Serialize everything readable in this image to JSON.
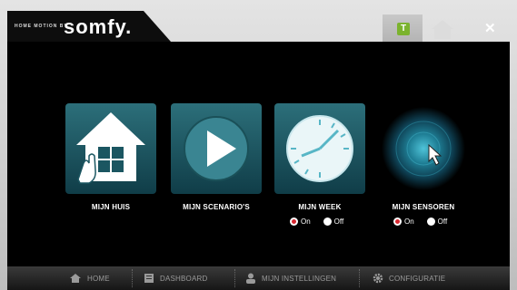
{
  "header": {
    "brand_small": "HOME MOTION BY",
    "brand_logo": "somfy.",
    "tab_t_label": "T",
    "close_label": "✕"
  },
  "tiles": [
    {
      "label": "MIJN HUIS",
      "icon": "house-hand-icon"
    },
    {
      "label": "MIJN SCENARIO'S",
      "icon": "play-icon"
    },
    {
      "label": "MIJN WEEK",
      "icon": "clock-icon",
      "options": [
        "On",
        "Off"
      ],
      "selected": "On"
    },
    {
      "label": "MIJN SENSOREN",
      "icon": "sensor-icon",
      "options": [
        "On",
        "Off"
      ],
      "selected": "On"
    }
  ],
  "bottom_nav": [
    {
      "label": "HOME",
      "icon": "home-icon"
    },
    {
      "label": "DASHBOARD",
      "icon": "dashboard-icon"
    },
    {
      "label": "MIJN INSTELLINGEN",
      "icon": "user-icon"
    },
    {
      "label": "CONFIGURATIE",
      "icon": "gear-icon"
    }
  ],
  "colors": {
    "accent_green": "#7bb32e",
    "radio_red": "#d7262f",
    "tile_top": "#2c6f7a",
    "tile_bottom": "#103d48"
  }
}
